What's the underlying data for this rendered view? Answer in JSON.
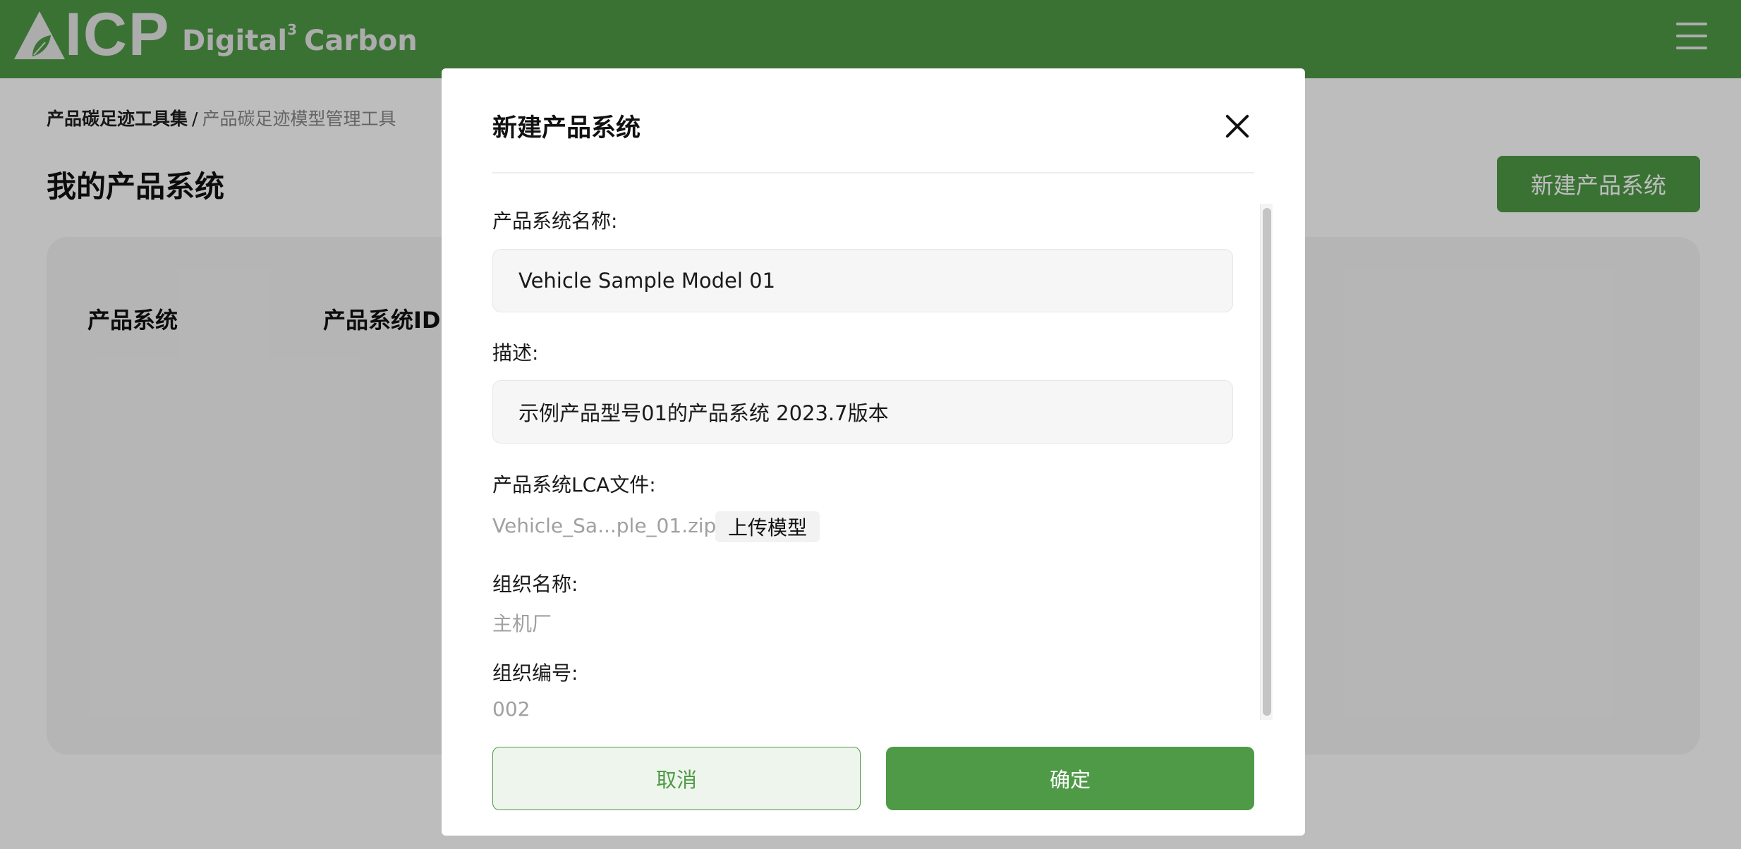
{
  "header": {
    "logo_text": "ICP",
    "brand_name": "Digital",
    "brand_superscript": "3",
    "brand_suffix": "Carbon",
    "menu_icon": "hamburger-menu-icon"
  },
  "breadcrumb": {
    "root": "产品碳足迹工具集",
    "separator": "/",
    "current": "产品碳足迹模型管理工具"
  },
  "page": {
    "title": "我的产品系统",
    "new_button_label": "新建产品系统",
    "table_headers": [
      "产品系统",
      "产品系统ID"
    ]
  },
  "modal": {
    "title": "新建产品系统",
    "close_icon": "close-icon",
    "fields": {
      "name": {
        "label": "产品系统名称:",
        "value": "Vehicle Sample Model 01"
      },
      "description": {
        "label": "描述:",
        "value": "示例产品型号01的产品系统 2023.7版本"
      },
      "lca_file": {
        "label": "产品系统LCA文件:",
        "filename": "Vehicle_Sa...ple_01.zip",
        "upload_label": "上传模型"
      },
      "org_name": {
        "label": "组织名称:",
        "value": "主机厂"
      },
      "org_id": {
        "label": "组织编号:",
        "value": "002"
      }
    },
    "cancel_label": "取消",
    "confirm_label": "确定"
  },
  "colors": {
    "brand_green": "#4f9a47",
    "overlay": "rgba(0,0,0,0.26)"
  }
}
